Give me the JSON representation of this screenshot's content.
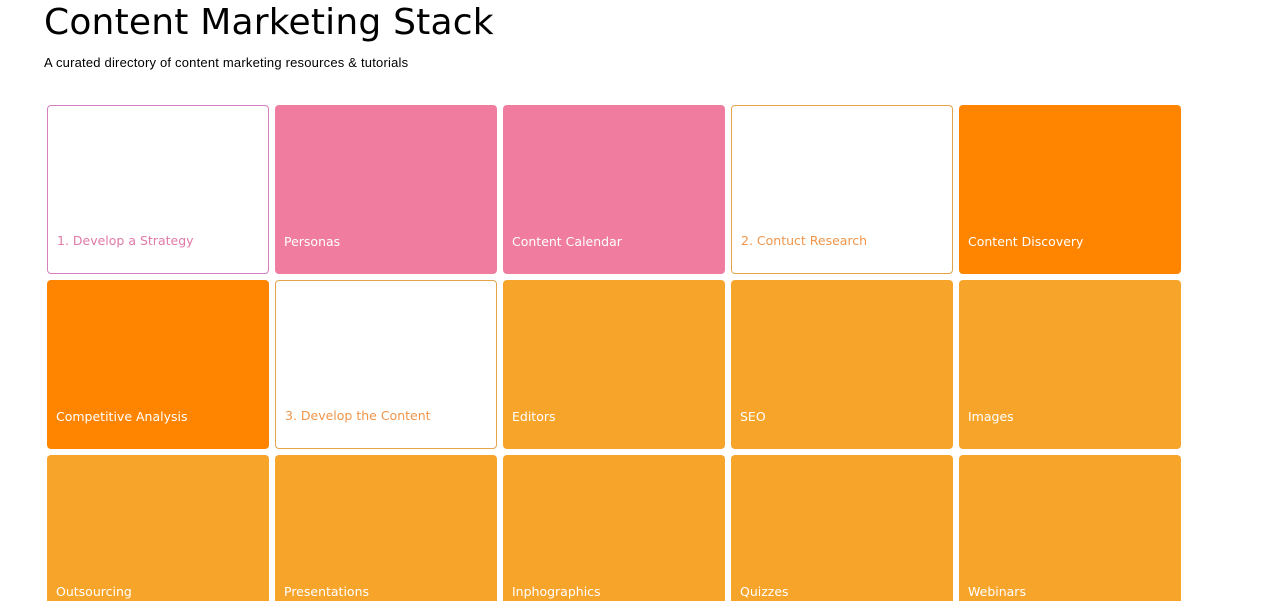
{
  "header": {
    "title": "Content Marketing Stack",
    "subtitle": "A curated directory of content marketing resources & tutorials"
  },
  "colors": {
    "pink": "#f07ca0",
    "pink_outline": "#d57fc0",
    "orange": "#ff8400",
    "amber": "#f7a42b",
    "orange_outline": "#e4a44b"
  },
  "tiles": [
    {
      "label": "1. Develop a Strategy",
      "style": "outline-pink"
    },
    {
      "label": "Personas",
      "style": "fill-pink"
    },
    {
      "label": "Content Calendar",
      "style": "fill-pink"
    },
    {
      "label": "2. Contuct Research",
      "style": "outline-orange"
    },
    {
      "label": "Content Discovery",
      "style": "fill-orange"
    },
    {
      "label": "Competitive Analysis",
      "style": "fill-orange"
    },
    {
      "label": "3. Develop the Content",
      "style": "outline-orange"
    },
    {
      "label": "Editors",
      "style": "fill-amber"
    },
    {
      "label": "SEO",
      "style": "fill-amber"
    },
    {
      "label": "Images",
      "style": "fill-amber"
    },
    {
      "label": "Outsourcing",
      "style": "fill-amber"
    },
    {
      "label": "Presentations",
      "style": "fill-amber"
    },
    {
      "label": "Inphographics",
      "style": "fill-amber"
    },
    {
      "label": "Quizzes",
      "style": "fill-amber"
    },
    {
      "label": "Webinars",
      "style": "fill-amber"
    }
  ]
}
